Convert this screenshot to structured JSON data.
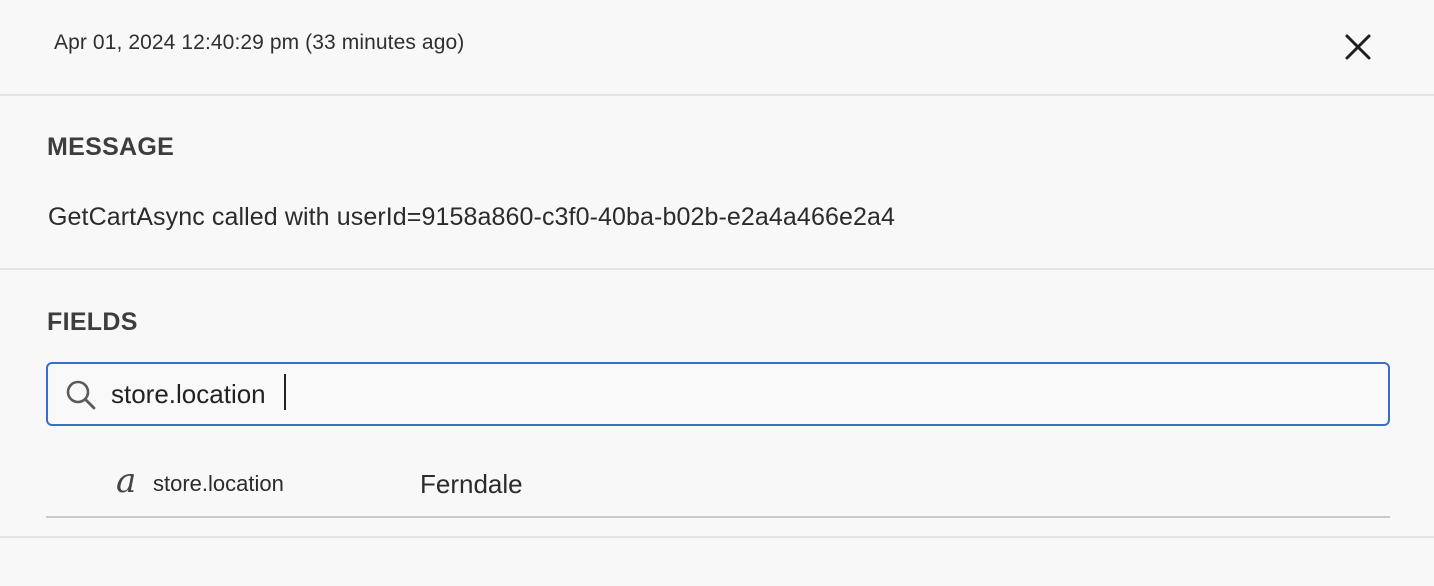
{
  "header": {
    "timestamp": "Apr 01, 2024 12:40:29 pm (33 minutes ago)",
    "close_icon": "close-icon"
  },
  "message": {
    "title": "MESSAGE",
    "body": "GetCartAsync called with userId=9158a860-c3f0-40ba-b02b-e2a4a466e2a4"
  },
  "fields": {
    "title": "FIELDS",
    "search": {
      "value": "store.location",
      "icon": "search-icon",
      "border_color": "#3b6fc6"
    },
    "rows": [
      {
        "type_icon": "a",
        "name": "store.location",
        "value": "Ferndale"
      }
    ]
  }
}
